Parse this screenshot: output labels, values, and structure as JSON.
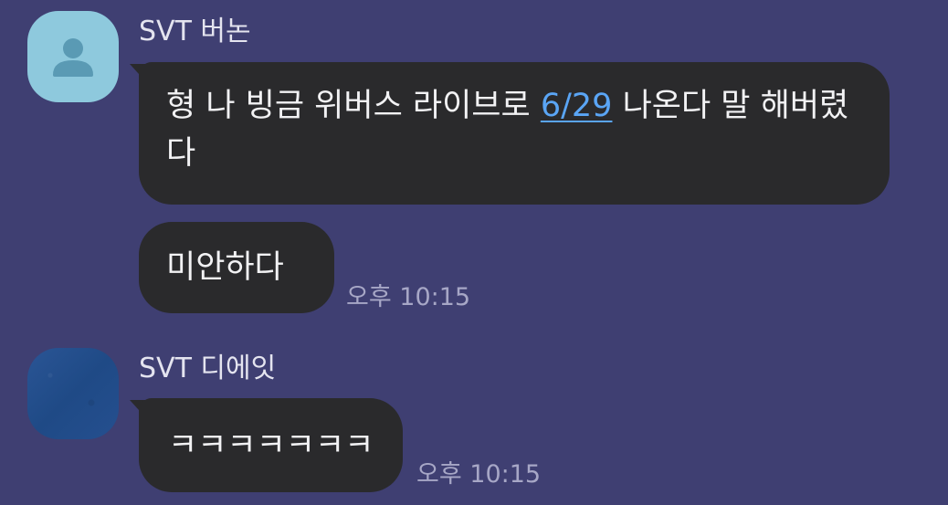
{
  "colors": {
    "background": "#3f3f72",
    "bubble": "#2a2a2c",
    "link": "#5aa5f5",
    "timestamp": "#a7a7c6"
  },
  "messages": [
    {
      "sender": "SVT 버논",
      "avatar_icon": "default-person-icon",
      "bubbles": [
        {
          "text_before": "형 나 빙금 위버스 라이브로 ",
          "link": "6/29",
          "text_after": " 나온다 말 해버렸다"
        },
        {
          "text": "미안하다",
          "time": "오후 10:15"
        }
      ]
    },
    {
      "sender": "SVT 디에잇",
      "avatar_icon": "profile-photo",
      "bubbles": [
        {
          "text": "ㅋㅋㅋㅋㅋㅋㅋ",
          "time": "오후 10:15"
        }
      ]
    }
  ]
}
